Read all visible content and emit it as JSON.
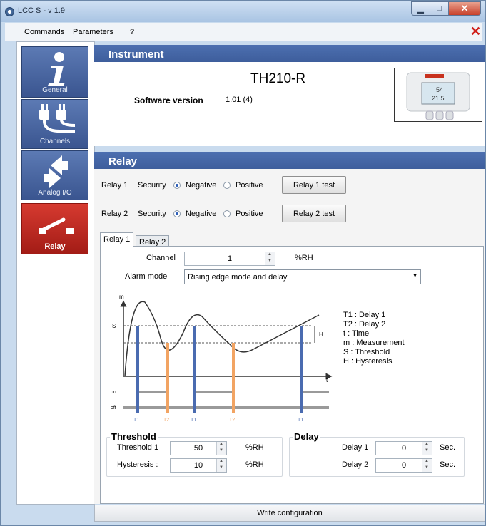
{
  "window": {
    "title": "LCC S - v 1.9",
    "min_glyph": "▁",
    "max_glyph": "□",
    "close_glyph": "✕"
  },
  "menu": {
    "items": [
      "Commands",
      "Parameters",
      "?"
    ]
  },
  "sidebar": {
    "items": [
      {
        "label": "General",
        "icon": "info-icon"
      },
      {
        "label": "Channels",
        "icon": "plugs-icon"
      },
      {
        "label": "Analog I/O",
        "icon": "arrows-icon"
      },
      {
        "label": "Relay",
        "icon": "relay-switch-icon",
        "active": true
      }
    ]
  },
  "instrument": {
    "header": "Instrument",
    "model": "TH210-R",
    "software_label": "Software version",
    "software_version": "1.01 (4)",
    "device_display": [
      "54",
      "21.5"
    ]
  },
  "relay": {
    "header": "Relay",
    "security_label": "Security",
    "negative_label": "Negative",
    "positive_label": "Positive",
    "relays": [
      {
        "label": "Relay 1",
        "security": "Negative",
        "test_button": "Relay 1 test"
      },
      {
        "label": "Relay 2",
        "security": "Negative",
        "test_button": "Relay 2 test"
      }
    ],
    "tabs": [
      "Relay 1",
      "Relay 2"
    ],
    "active_tab": "Relay 1",
    "channel_label": "Channel",
    "channel_value": "1",
    "channel_unit": "%RH",
    "alarm_mode_label": "Alarm mode",
    "alarm_mode_value": "Rising edge mode and delay",
    "diagram": {
      "axis_m": "m",
      "axis_t": "t",
      "s_label": "S",
      "h_label": "H",
      "on_label": "on",
      "off_label": "off",
      "markers": [
        "T1",
        "T2",
        "T1",
        "T2",
        "T1"
      ],
      "legend": [
        "T1 : Delay 1",
        "T2 : Delay 2",
        "t : Time",
        "m : Measurement",
        "S : Threshold",
        "H : Hysteresis"
      ],
      "colors": {
        "t1": "#4a6bb0",
        "t2": "#f2a463",
        "curve": "#333333",
        "state": "#9a9a9a"
      }
    },
    "threshold_group": {
      "title": "Threshold",
      "threshold_label": "Threshold 1",
      "threshold_value": "50",
      "threshold_unit": "%RH",
      "hysteresis_label": "Hysteresis :",
      "hysteresis_value": "10",
      "hysteresis_unit": "%RH"
    },
    "delay_group": {
      "title": "Delay",
      "delay1_label": "Delay 1",
      "delay1_value": "0",
      "delay1_unit": "Sec.",
      "delay2_label": "Delay 2",
      "delay2_value": "0",
      "delay2_unit": "Sec."
    },
    "write_button": "Write configuration"
  }
}
